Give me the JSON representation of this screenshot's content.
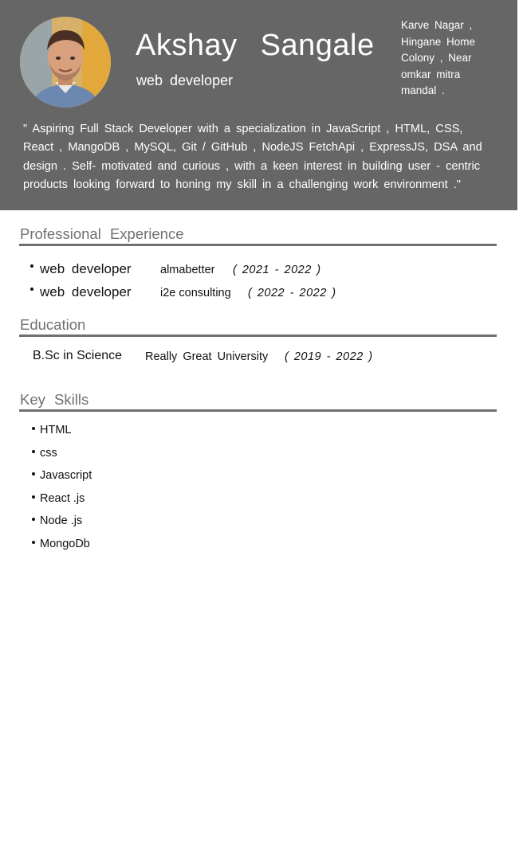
{
  "header": {
    "name": "Akshay   Sangale",
    "role": "web  developer",
    "address": "Karve Nagar , Hingane  Home Colony , Near omkar  mitra mandal  .",
    "summary": "\" Aspiring  Full Stack Developer  with  a specialization   in JavaScript  , HTML, CSS, React , MangoDB , MySQL, Git / GitHub , NodeJS FetchApi , ExpressJS, DSA and design . Self- motivated   and  curious , with  a keen  interest  in building  user - centric  products  looking  forward  to honing  my  skill in a challenging   work environment  .\""
  },
  "experience": {
    "title": "Professional   Experience",
    "items": [
      {
        "role": "web  developer",
        "company": "almabetter",
        "dates": "( 2021 -  2022 )"
      },
      {
        "role": "web  developer",
        "company": "i2e consulting",
        "dates": "( 2022  -  2022 )"
      }
    ]
  },
  "education": {
    "title": "Education",
    "degree": "B.Sc in  Science",
    "school": "Really  Great  University",
    "dates": "( 2019 -  2022 )"
  },
  "skills": {
    "title": "Key Skills",
    "items": [
      "HTML",
      "css",
      "Javascript",
      "React .js",
      "Node .js",
      "MongoDb"
    ]
  },
  "colors": {
    "header_bg": "#666666",
    "section_gray": "#707070"
  }
}
